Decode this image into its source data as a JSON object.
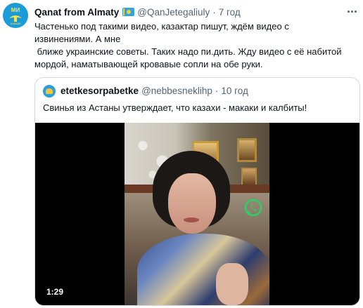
{
  "tweet": {
    "avatar": {
      "top_text": "МИ",
      "bottom_text": "Э-ВАШЕ",
      "icon": "kazakhstan-emblem-icon"
    },
    "display_name": "Qanat from Almaty",
    "flag_icon": "kazakhstan-flag-icon",
    "handle": "@QanJetegaliuly",
    "separator": "·",
    "time": "7 год",
    "more_icon": "more-horizontal-icon",
    "text_lines": [
      "Частенько под такими видео, казактар пишут, ждём видео с",
      "извинениями. А мне",
      " ближе украинские советы. Таких надо пи.дить. Жду видео с её набитой",
      "мордой, наматывающей кровавые сопли на обе руки."
    ]
  },
  "quote": {
    "avatar_icon": "quoted-user-avatar",
    "display_name": "etetkesorpabetke",
    "handle": "@nebbesneklihp",
    "separator": "·",
    "time": "10 год",
    "text": "Свинья из Астаны утверждает, что казахи - макаки и калбиты!",
    "video": {
      "duration": "1:29",
      "watermark_icon": "whatsapp-icon"
    }
  },
  "colors": {
    "text_primary": "#0f1419",
    "text_secondary": "#536471",
    "border": "#cfd9de",
    "video_bg": "#000000",
    "whatsapp_green": "#25d366"
  }
}
